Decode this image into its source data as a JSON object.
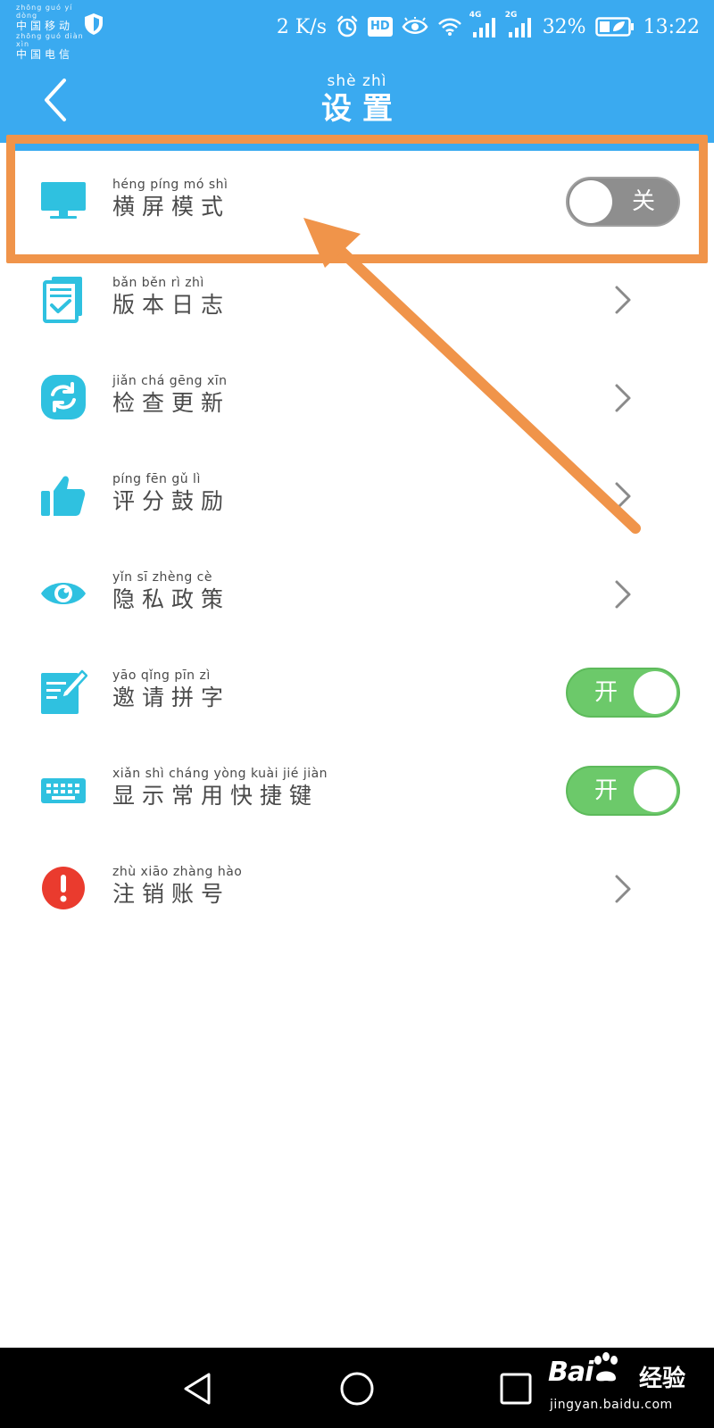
{
  "status_bar": {
    "carrier1_pinyin": "zhōng guó   yí   dòng",
    "carrier1_name": "中国移动",
    "carrier2_pinyin": "zhōng guó diàn  xìn",
    "carrier2_name": "中国电信",
    "net_speed": "2 K/s",
    "hd_badge": "HD",
    "sim1_tag": "4G",
    "sim2_tag": "2G",
    "battery_percent": "32%",
    "time": "13:22"
  },
  "header": {
    "title_pinyin": "shè  zhì",
    "title": "设置"
  },
  "settings": [
    {
      "icon": "monitor-icon",
      "pinyin": "héng píng  mó   shì",
      "label": "横屏模式",
      "control": "toggle",
      "state": "off",
      "toggle_text": "关"
    },
    {
      "icon": "document-icon",
      "pinyin": "bǎn   běn    rì    zhì",
      "label": "版本日志",
      "control": "chevron"
    },
    {
      "icon": "refresh-icon",
      "pinyin": "jiǎn  chá  gēng  xīn",
      "label": "检查更新",
      "control": "chevron"
    },
    {
      "icon": "thumbs-up-icon",
      "pinyin": "píng  fēn   gǔ     lì",
      "label": "评分鼓励",
      "control": "chevron"
    },
    {
      "icon": "eye-icon",
      "pinyin": "yǐn    sī   zhèng  cè",
      "label": "隐私政策",
      "control": "chevron"
    },
    {
      "icon": "edit-icon",
      "pinyin": "yāo  qǐng  pīn    zì",
      "label": "邀请拼字",
      "control": "toggle",
      "state": "on",
      "toggle_text": "开"
    },
    {
      "icon": "keyboard-icon",
      "pinyin": "xiǎn  shì  cháng yòng kuài  jié   jiàn",
      "label": "显示常用快捷键",
      "control": "toggle",
      "state": "on",
      "toggle_text": "开"
    },
    {
      "icon": "alert-icon",
      "pinyin": "zhù  xiāo zhàng hào",
      "label": "注销账号",
      "control": "chevron"
    }
  ],
  "watermark": {
    "logo_text": "Bai",
    "logo_suffix": "经验",
    "url": "jingyan.baidu.com"
  },
  "colors": {
    "header_blue": "#3aaaf0",
    "icon_blue": "#2fc1e0",
    "toggle_on": "#6cc96a",
    "toggle_off": "#8e8e8e",
    "alert_red": "#ea3b2e",
    "annotation_orange": "#f0944a"
  }
}
